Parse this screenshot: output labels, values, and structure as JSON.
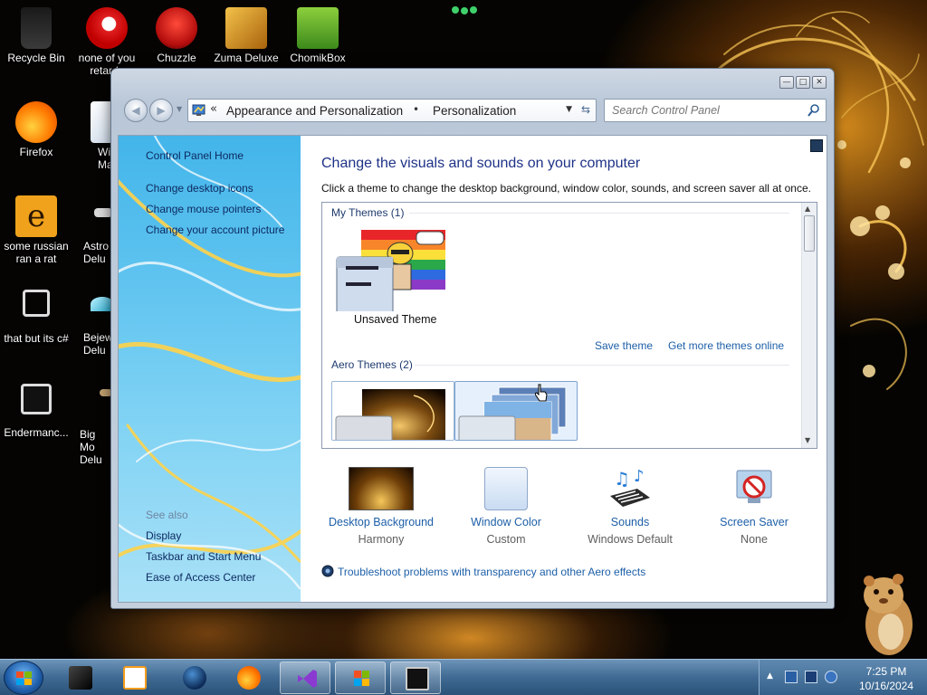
{
  "desktop": {
    "icons": [
      {
        "name": "recycle-bin",
        "label": "Recycle Bin"
      },
      {
        "name": "none-of-you",
        "label": "none of you\nretards"
      },
      {
        "name": "chuzzle",
        "label": "Chuzzle"
      },
      {
        "name": "zuma-deluxe",
        "label": "Zuma Deluxe"
      },
      {
        "name": "chomikbox",
        "label": "ChomikBox"
      },
      {
        "name": "firefox",
        "label": "Firefox"
      },
      {
        "name": "windows-media",
        "label": "Window\nMa"
      },
      {
        "name": "some-russian",
        "label": "some russian\nran a rat"
      },
      {
        "name": "astro-deluxe",
        "label": "Astro\nDelu"
      },
      {
        "name": "that-but-its-c",
        "label": "that but its c#"
      },
      {
        "name": "bejeweled-deluxe",
        "label": "Bejew\nDelu"
      },
      {
        "name": "endermanc",
        "label": "Endermanc..."
      },
      {
        "name": "big-money-deluxe",
        "label": "Big Mo\nDelu"
      }
    ]
  },
  "window": {
    "buttons": {
      "minimize": "—",
      "maximize": "□",
      "close": "✕"
    },
    "address": {
      "chevron": "«",
      "crumbs": [
        "Appearance and Personalization",
        "Personalization"
      ],
      "separator": "•"
    },
    "search": {
      "placeholder": "Search Control Panel"
    },
    "left_pane": {
      "links": [
        "Control Panel Home",
        "Change desktop icons",
        "Change mouse pointers",
        "Change your account picture"
      ],
      "see_also_title": "See also",
      "see_also": [
        "Display",
        "Taskbar and Start Menu",
        "Ease of Access Center"
      ]
    },
    "main": {
      "title": "Change the visuals and sounds on your computer",
      "description": "Click a theme to change the desktop background, window color, sounds, and screen saver all at once.",
      "my_themes": {
        "title": "My Themes (1)",
        "theme_name": "Unsaved Theme"
      },
      "links": {
        "save": "Save theme",
        "more": "Get more themes online"
      },
      "aero_themes": {
        "title": "Aero Themes (2)"
      },
      "tools": [
        {
          "label": "Desktop Background",
          "sub": "Harmony"
        },
        {
          "label": "Window Color",
          "sub": "Custom"
        },
        {
          "label": "Sounds",
          "sub": "Windows Default"
        },
        {
          "label": "Screen Saver",
          "sub": "None"
        }
      ],
      "troubleshoot": "Troubleshoot problems with transparency and other Aero effects"
    }
  },
  "taskbar": {
    "items": [
      "black-cube-app",
      "media-player",
      "steam",
      "firefox",
      "visual-studio",
      "windows-flag-app",
      "control-panel"
    ],
    "clock": {
      "time": "7:25 PM",
      "date": "10/16/2024"
    }
  },
  "colors": {
    "link": "#1d5fa8",
    "title": "#1e3287",
    "taskbar": "#3f6a93"
  }
}
